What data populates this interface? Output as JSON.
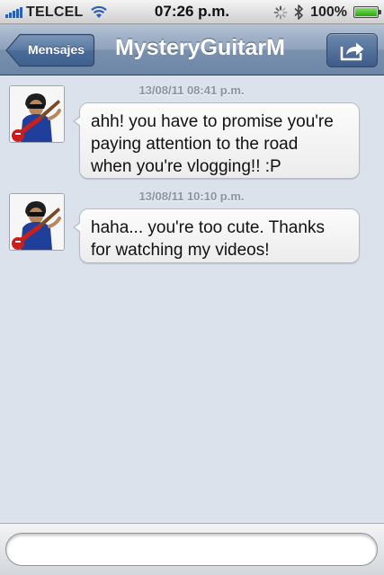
{
  "status_bar": {
    "carrier": "TELCEL",
    "time": "07:26 p.m.",
    "battery": "100%",
    "battery_level": 1.0
  },
  "nav": {
    "back_label": "Mensajes",
    "title": "MysteryGuitarM",
    "action_icon": "share-icon"
  },
  "messages": [
    {
      "timestamp": "13/08/11 08:41 p.m.",
      "lines": [
        "ahh! you have to promise you're",
        "paying attention to the road",
        "when you're vlogging!! :P"
      ]
    },
    {
      "timestamp": "13/08/11 10:10 p.m.",
      "lines": [
        "haha... you're too cute. Thanks",
        "for watching my videos!"
      ]
    }
  ],
  "input": {
    "placeholder": ""
  },
  "colors": {
    "background": "#dbe2ec",
    "navbar": "#7a91ae",
    "timestamp": "#8a93a0",
    "guitar": "#c8201e",
    "shirt": "#1f3f9a"
  }
}
